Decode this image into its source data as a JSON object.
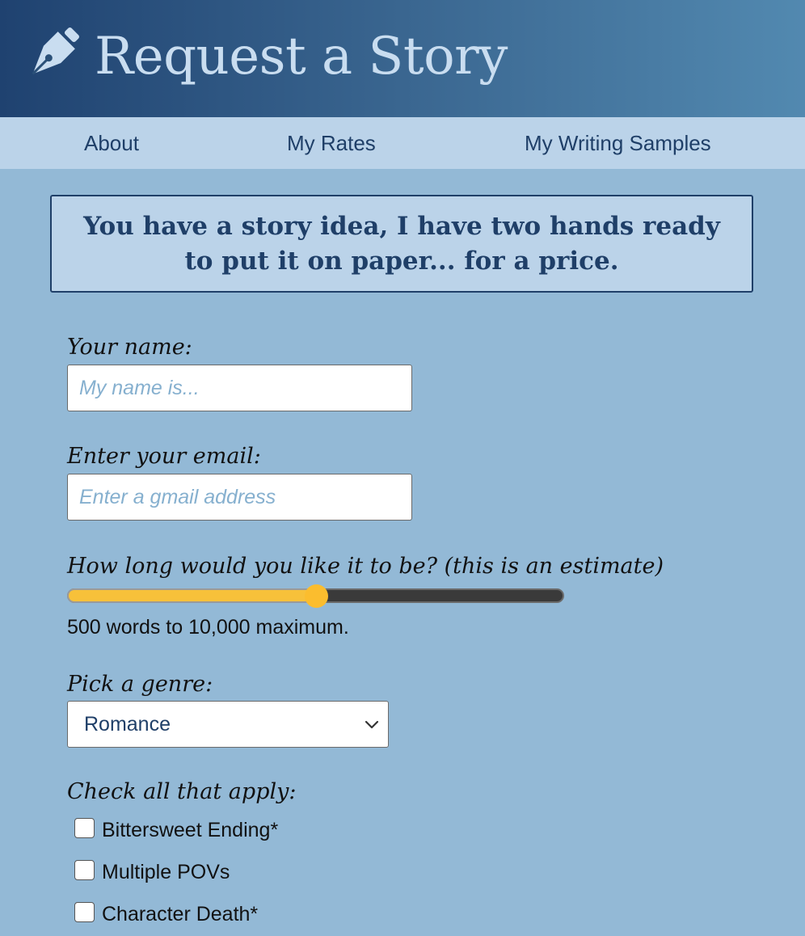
{
  "header": {
    "title": "Request a Story",
    "logo_icon": "fountain-pen-icon"
  },
  "nav": {
    "items": [
      {
        "label": "About"
      },
      {
        "label": "My Rates"
      },
      {
        "label": "My Writing Samples"
      }
    ]
  },
  "tagline": "You have a story idea, I have two hands ready to put it on paper... for a price.",
  "form": {
    "name": {
      "label": "Your name:",
      "placeholder": "My name is...",
      "value": ""
    },
    "email": {
      "label": "Enter your email:",
      "placeholder": "Enter a gmail address",
      "value": ""
    },
    "length": {
      "label": "How long would you like it to be? (this is an estimate)",
      "note": "500 words to 10,000 maximum.",
      "fraction": 0.5
    },
    "genre": {
      "label": "Pick a genre:",
      "selected": "Romance"
    },
    "checks": {
      "label": "Check all that apply:",
      "options": [
        {
          "label": "Bittersweet Ending*",
          "checked": false
        },
        {
          "label": "Multiple POVs",
          "checked": false
        },
        {
          "label": "Character Death*",
          "checked": false
        }
      ]
    }
  },
  "colors": {
    "page_bg": "#93b9d6",
    "header_dark": "#1f4270",
    "header_light": "#5289b0",
    "nav_bg": "#bbd3e9",
    "accent_text": "#1f3f68",
    "slider_fill": "#f7c13a",
    "placeholder": "#86b0cf"
  }
}
